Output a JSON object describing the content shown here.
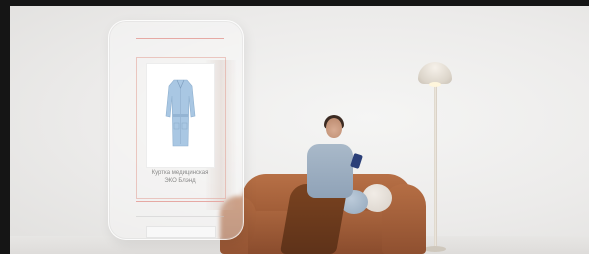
{
  "product": {
    "caption_line1": "Куртка медицинская",
    "caption_line2": "ЭКО Блэнд"
  },
  "scene": {
    "garment_color": "#a9c7e3",
    "sofa_color": "#a9653e",
    "background_color": "#ecebea"
  }
}
